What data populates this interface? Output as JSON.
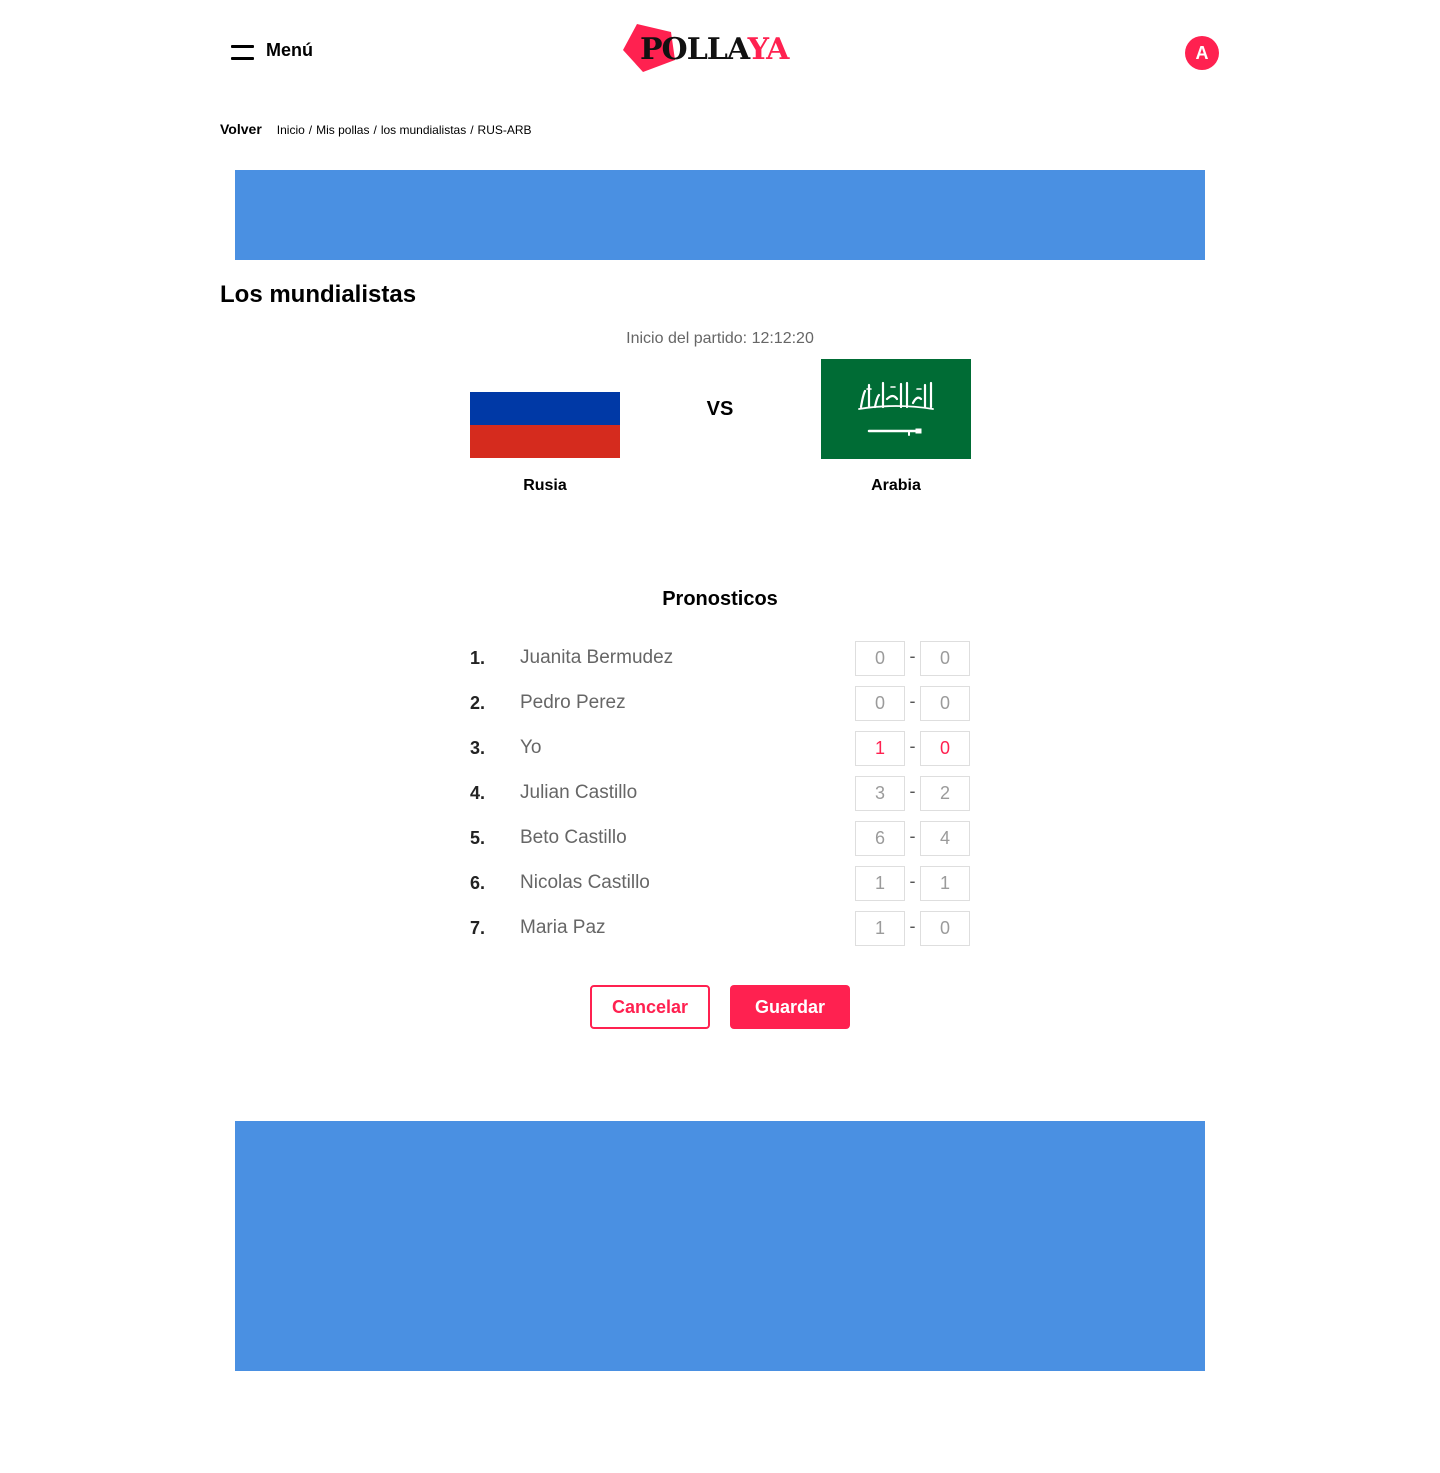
{
  "header": {
    "menu_label": "Menú",
    "logo_part1": "POLLA",
    "logo_part2": "YA",
    "avatar_initial": "A"
  },
  "breadcrumb": {
    "back_label": "Volver",
    "items": [
      "Inicio",
      "Mis pollas",
      "los mundialistas",
      "RUS-ARB"
    ],
    "separator": "/"
  },
  "pool": {
    "title": "Los mundialistas"
  },
  "match": {
    "start_label": "Inicio del partido: 12:12:20",
    "vs_label": "VS",
    "home_team": {
      "name": "Rusia",
      "flag": "russia-flag",
      "colors": [
        "#ffffff",
        "#0039a6",
        "#d52b1e"
      ]
    },
    "away_team": {
      "name": "Arabia",
      "flag": "saudi-arabia-flag",
      "colors": [
        "#006c35",
        "#ffffff"
      ]
    }
  },
  "predictions": {
    "title": "Pronosticos",
    "rows": [
      {
        "rank": "1.",
        "name": "Juanita Bermudez",
        "home": "0",
        "away": "0",
        "editable": false
      },
      {
        "rank": "2.",
        "name": "Pedro Perez",
        "home": "0",
        "away": "0",
        "editable": false
      },
      {
        "rank": "3.",
        "name": "Yo",
        "home": "1",
        "away": "0",
        "editable": true
      },
      {
        "rank": "4.",
        "name": "Julian Castillo",
        "home": "3",
        "away": "2",
        "editable": false
      },
      {
        "rank": "5.",
        "name": "Beto Castillo",
        "home": "6",
        "away": "4",
        "editable": false
      },
      {
        "rank": "6.",
        "name": "Nicolas Castillo",
        "home": "1",
        "away": "1",
        "editable": false
      },
      {
        "rank": "7.",
        "name": "Maria Paz",
        "home": "1",
        "away": "0",
        "editable": false
      }
    ],
    "dash": "-"
  },
  "actions": {
    "cancel_label": "Cancelar",
    "save_label": "Guardar"
  },
  "colors": {
    "brand": "#ff2150",
    "ad_placeholder": "#4a90e2"
  }
}
